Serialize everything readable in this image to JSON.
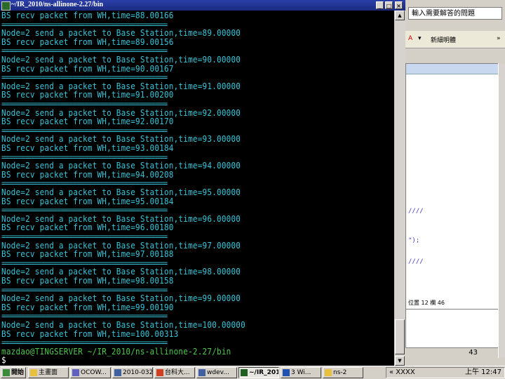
{
  "terminal": {
    "title": "~/IR_2010/ns-allinone-2.27/bin",
    "lines": [
      {
        "type": "recv",
        "text": "BS recv packet from WH,time=88.00166"
      },
      {
        "type": "sep",
        "text": "=========================================="
      },
      {
        "type": "send",
        "text": "Node=2 send a packet to Base Station,time=89.00000"
      },
      {
        "type": "recv",
        "text": "BS recv packet from WH,time=89.00156"
      },
      {
        "type": "sep",
        "text": "=========================================="
      },
      {
        "type": "send",
        "text": "Node=2 send a packet to Base Station,time=90.00000"
      },
      {
        "type": "recv",
        "text": "BS recv packet from WH,time=90.00167"
      },
      {
        "type": "sep",
        "text": "=========================================="
      },
      {
        "type": "send",
        "text": "Node=2 send a packet to Base Station,time=91.00000"
      },
      {
        "type": "recv",
        "text": "BS recv packet from WH,time=91.00200"
      },
      {
        "type": "sep",
        "text": "=========================================="
      },
      {
        "type": "send",
        "text": "Node=2 send a packet to Base Station,time=92.00000"
      },
      {
        "type": "recv",
        "text": "BS recv packet from WH,time=92.00170"
      },
      {
        "type": "sep",
        "text": "=========================================="
      },
      {
        "type": "send",
        "text": "Node=2 send a packet to Base Station,time=93.00000"
      },
      {
        "type": "recv",
        "text": "BS recv packet from WH,time=93.00184"
      },
      {
        "type": "sep",
        "text": "=========================================="
      },
      {
        "type": "send",
        "text": "Node=2 send a packet to Base Station,time=94.00000"
      },
      {
        "type": "recv",
        "text": "BS recv packet from WH,time=94.00208"
      },
      {
        "type": "sep",
        "text": "=========================================="
      },
      {
        "type": "send",
        "text": "Node=2 send a packet to Base Station,time=95.00000"
      },
      {
        "type": "recv",
        "text": "BS recv packet from WH,time=95.00184"
      },
      {
        "type": "sep",
        "text": "=========================================="
      },
      {
        "type": "send",
        "text": "Node=2 send a packet to Base Station,time=96.00000"
      },
      {
        "type": "recv",
        "text": "BS recv packet from WH,time=96.00180"
      },
      {
        "type": "sep",
        "text": "=========================================="
      },
      {
        "type": "send",
        "text": "Node=2 send a packet to Base Station,time=97.00000"
      },
      {
        "type": "recv",
        "text": "BS recv packet from WH,time=97.00188"
      },
      {
        "type": "sep",
        "text": "=========================================="
      },
      {
        "type": "send",
        "text": "Node=2 send a packet to Base Station,time=98.00000"
      },
      {
        "type": "recv",
        "text": "BS recv packet from WH,time=98.00158"
      },
      {
        "type": "sep",
        "text": "=========================================="
      },
      {
        "type": "send",
        "text": "Node=2 send a packet to Base Station,time=99.00000"
      },
      {
        "type": "recv",
        "text": "BS recv packet from WH,time=99.00190"
      },
      {
        "type": "sep",
        "text": "=========================================="
      },
      {
        "type": "send",
        "text": "Node=2 send a packet to Base Station,time=100.00000"
      },
      {
        "type": "recv",
        "text": "BS recv packet from WH,time=100.00313"
      },
      {
        "type": "sep",
        "text": "=========================================="
      },
      {
        "type": "prompt",
        "text": "mazdao@TINGSERVER ~/IR_2010/ns-allinone-2.27/bin"
      },
      {
        "type": "cursor",
        "text": "$"
      }
    ]
  },
  "right_app": {
    "ask_box": "輸入需要解答的問題",
    "toolbar_label": "新細明體",
    "page_number": "43",
    "code_fragments": [
      "////",
      "\");",
      "////"
    ],
    "ruler_text": "位置 12 欄 46"
  },
  "taskbar": {
    "start_label": "開始",
    "tasks": [
      {
        "label": "主畫面",
        "icon": "folder-icon",
        "active": false
      },
      {
        "label": "OCOW...",
        "icon": "app-icon",
        "active": false
      },
      {
        "label": "2010-032",
        "icon": "doc-icon",
        "active": false
      },
      {
        "label": "台科大...",
        "icon": "browser-icon",
        "active": false
      },
      {
        "label": "wdev...",
        "icon": "doc-icon",
        "active": false
      },
      {
        "label": "~/IR_2010...",
        "icon": "terminal-icon",
        "active": true
      },
      {
        "label": "3 Wi...",
        "icon": "word-icon",
        "active": false
      },
      {
        "label": "ns-2",
        "icon": "folder-icon",
        "active": false
      }
    ],
    "tray_text": "« XXXX",
    "clock": "上午 12:47"
  }
}
